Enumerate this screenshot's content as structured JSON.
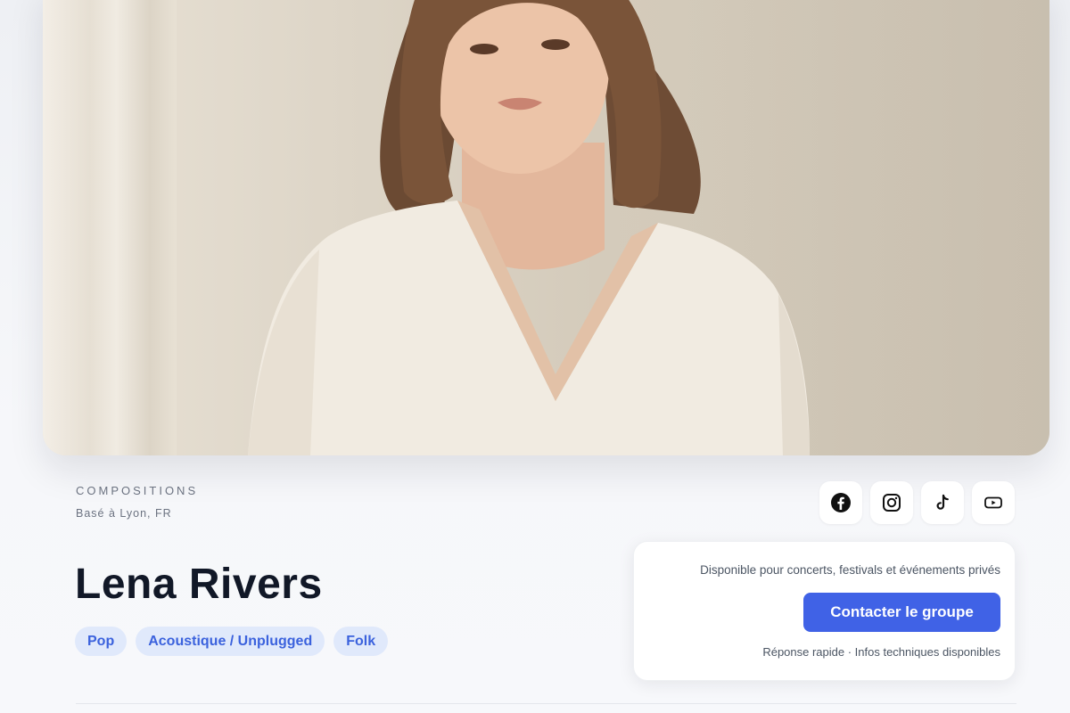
{
  "hero": {
    "image_alt": "Portrait of Lena Rivers"
  },
  "profile": {
    "eyebrow": "COMPOSITIONS",
    "location": "Basé à Lyon, FR",
    "name": "Lena Rivers",
    "tags": [
      "Pop",
      "Acoustique / Unplugged",
      "Folk"
    ]
  },
  "socials": [
    {
      "name": "facebook-icon",
      "label": "Facebook"
    },
    {
      "name": "instagram-icon",
      "label": "Instagram"
    },
    {
      "name": "tiktok-icon",
      "label": "TikTok"
    },
    {
      "name": "youtube-icon",
      "label": "YouTube"
    }
  ],
  "booking": {
    "availability": "Disponible pour concerts, festivals et événements privés",
    "cta_label": "Contacter le groupe",
    "note": "Réponse rapide · Infos techniques disponibles"
  },
  "colors": {
    "accent": "#4062e6",
    "tag_bg": "#e0e9fb",
    "tag_text": "#3b62dd",
    "text_dark": "#111827"
  }
}
